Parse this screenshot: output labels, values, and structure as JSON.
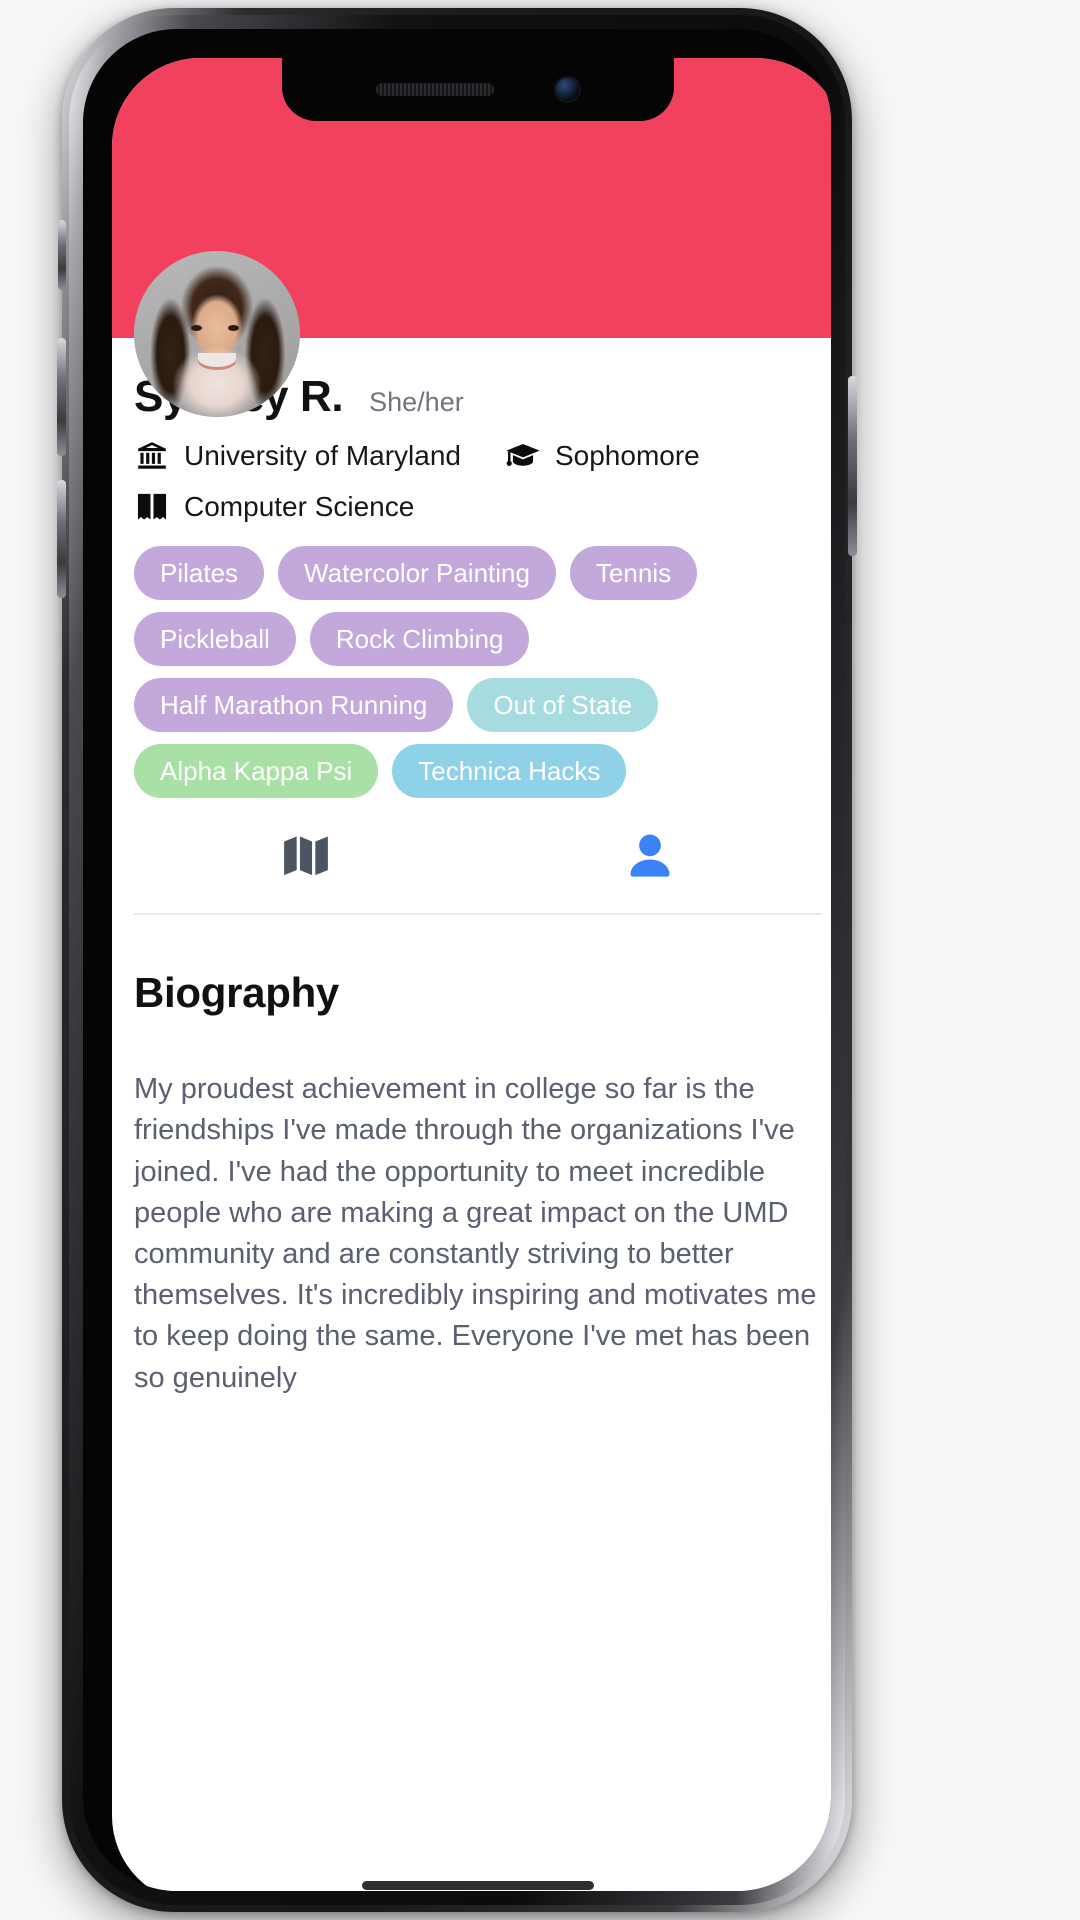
{
  "device": {
    "notch": {
      "speaker": "earpiece-speaker",
      "camera": "front-camera"
    },
    "buttons": [
      "silent-switch",
      "volume-up",
      "volume-down",
      "power"
    ]
  },
  "theme": {
    "header_accent": "#F2415E",
    "tag_purple": "#C3A8DC",
    "tag_teal": "#A6DCDF",
    "tag_green": "#A9E0A5",
    "tag_blue": "#8FD2E8",
    "tab_active": "#3B82F6",
    "tab_inactive": "#4B5563",
    "body_text": "#5A6070"
  },
  "profile": {
    "avatar_alt": "profile-photo",
    "name": "Sydney R.",
    "pronouns": "She/her",
    "details": [
      {
        "icon": "university-icon",
        "label": "University of Maryland"
      },
      {
        "icon": "graduation-cap-icon",
        "label": "Sophomore"
      },
      {
        "icon": "book-icon",
        "label": "Computer Science"
      }
    ],
    "tag_rows": [
      [
        {
          "label": "Pilates",
          "color": "#C3A8DC"
        },
        {
          "label": "Watercolor Painting",
          "color": "#C3A8DC"
        },
        {
          "label": "Tennis",
          "color": "#C3A8DC"
        }
      ],
      [
        {
          "label": "Pickleball",
          "color": "#C3A8DC"
        },
        {
          "label": "Rock Climbing",
          "color": "#C3A8DC"
        }
      ],
      [
        {
          "label": "Half Marathon Running",
          "color": "#C3A8DC"
        },
        {
          "label": "Out of State",
          "color": "#A6DCDF"
        }
      ],
      [
        {
          "label": "Alpha Kappa Psi",
          "color": "#A9E0A5"
        },
        {
          "label": "Technica Hacks",
          "color": "#8FD2E8"
        }
      ]
    ]
  },
  "tabs": [
    {
      "name": "map-tab",
      "icon": "map-icon",
      "active": false
    },
    {
      "name": "profile-tab",
      "icon": "person-icon",
      "active": true
    }
  ],
  "biography": {
    "title": "Biography",
    "text": "My proudest achievement in college so far is the friendships I've made through the organizations I've joined. I've had the opportunity to meet incredible people who are making a great impact on the UMD community and are constantly striving to better themselves. It's incredibly inspiring and motivates me to keep doing the same. Everyone I've met has been so genuinely"
  }
}
